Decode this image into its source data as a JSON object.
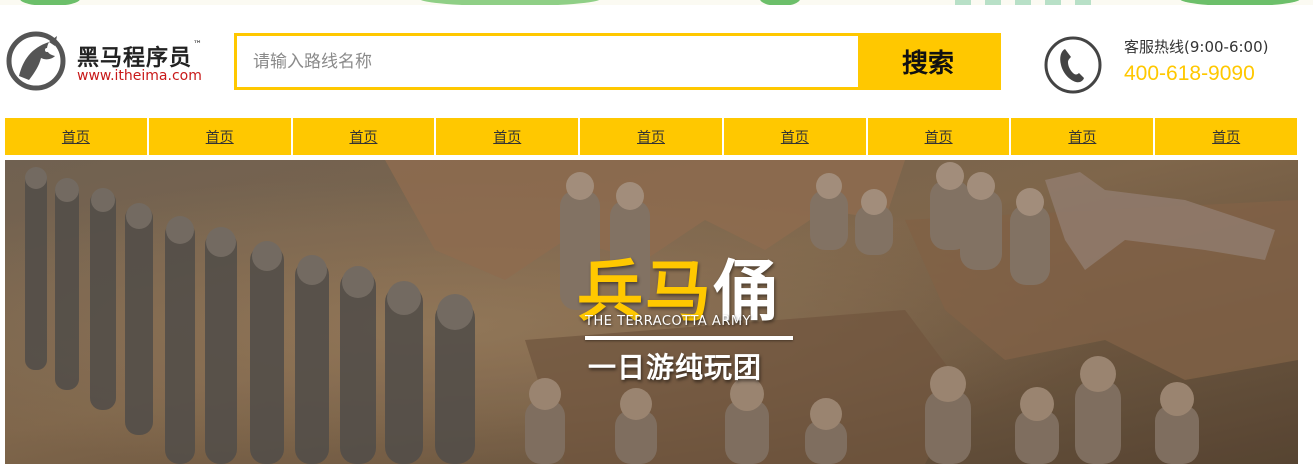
{
  "logo": {
    "name": "黑马程序员",
    "trademark": "™",
    "url": "www.itheima.com"
  },
  "search": {
    "placeholder": "请输入路线名称",
    "button_label": "搜索"
  },
  "hotline": {
    "label": "客服热线(9:00-6:00)",
    "number": "400-618-9090"
  },
  "nav": {
    "items": [
      {
        "label": "首页"
      },
      {
        "label": "首页"
      },
      {
        "label": "首页"
      },
      {
        "label": "首页"
      },
      {
        "label": "首页"
      },
      {
        "label": "首页"
      },
      {
        "label": "首页"
      },
      {
        "label": "首页"
      },
      {
        "label": "首页"
      }
    ]
  },
  "banner": {
    "title_part1": "兵马",
    "title_part2": "俑",
    "subtitle": "THE TERRACOTTA ARMY",
    "tagline": "一日游纯玩团"
  },
  "colors": {
    "accent": "#ffc800",
    "brand_red": "#c81919"
  },
  "icons": {
    "logo": "horse-head-logo-icon",
    "phone": "phone-handset-icon"
  }
}
